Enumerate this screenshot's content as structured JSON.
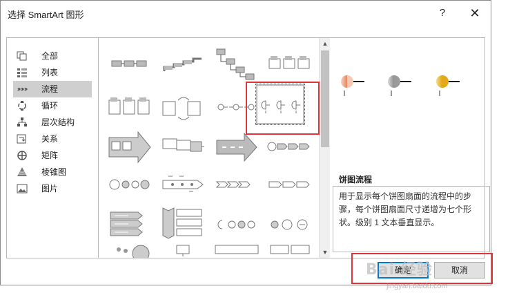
{
  "dialog": {
    "title": "选择 SmartArt 图形",
    "help_label": "?",
    "close_label": "✕",
    "ok_label": "确定",
    "cancel_label": "取消"
  },
  "categories": [
    {
      "label": "全部",
      "icon": "all-icon"
    },
    {
      "label": "列表",
      "icon": "list-icon"
    },
    {
      "label": "流程",
      "icon": "process-icon",
      "selected": true
    },
    {
      "label": "循环",
      "icon": "cycle-icon"
    },
    {
      "label": "层次结构",
      "icon": "hierarchy-icon"
    },
    {
      "label": "关系",
      "icon": "relationship-icon"
    },
    {
      "label": "矩阵",
      "icon": "matrix-icon"
    },
    {
      "label": "棱锥图",
      "icon": "pyramid-icon"
    },
    {
      "label": "图片",
      "icon": "picture-icon"
    }
  ],
  "preview": {
    "title": "饼图流程",
    "description": "用于显示每个饼图扇面的流程中的步骤，每个饼图扇面尺寸递增为七个形状。级别 1 文本垂直显示。"
  },
  "watermark": {
    "main": "Bai 经验",
    "sub": "jingyan.baidu.com"
  },
  "colors": {
    "accent": "#0078d7",
    "highlight": "#e0333a",
    "selected_category": "#cfcfcf"
  }
}
